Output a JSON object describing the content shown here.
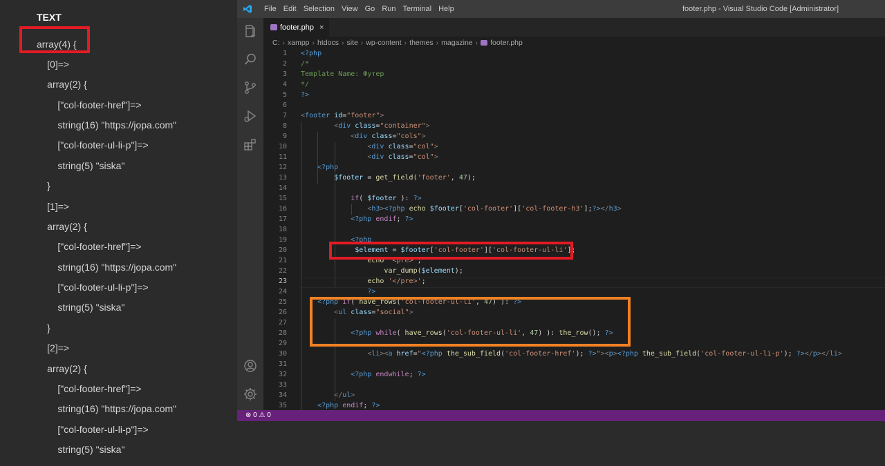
{
  "dump": {
    "title": "TEXT",
    "lines": [
      "array(4) {",
      "  [0]=>",
      "  array(2) {",
      "    [\"col-footer-href\"]=>",
      "    string(16) \"https://jopa.com\"",
      "    [\"col-footer-ul-li-p\"]=>",
      "    string(5) \"siska\"",
      "  }",
      "  [1]=>",
      "  array(2) {",
      "    [\"col-footer-href\"]=>",
      "    string(16) \"https://jopa.com\"",
      "    [\"col-footer-ul-li-p\"]=>",
      "    string(5) \"siska\"",
      "  }",
      "  [2]=>",
      "  array(2) {",
      "    [\"col-footer-href\"]=>",
      "    string(16) \"https://jopa.com\"",
      "    [\"col-footer-ul-li-p\"]=>",
      "    string(5) \"siska\""
    ]
  },
  "window": {
    "title": "footer.php - Visual Studio Code [Administrator]",
    "menu": [
      "File",
      "Edit",
      "Selection",
      "View",
      "Go",
      "Run",
      "Terminal",
      "Help"
    ]
  },
  "tab": {
    "name": "footer.php",
    "close": "×"
  },
  "breadcrumb": [
    "C:",
    "xampp",
    "htdocs",
    "site",
    "wp-content",
    "themes",
    "magazine",
    "footer.php"
  ],
  "editor": {
    "active_line": 23,
    "line_numbers": [
      "1",
      "2",
      "3",
      "4",
      "5",
      "6",
      "7",
      "8",
      "9",
      "10",
      "11",
      "12",
      "13",
      "14",
      "15",
      "16",
      "17",
      "18",
      "19",
      "20",
      "21",
      "22",
      "23",
      "24",
      "25",
      "26",
      "27",
      "28",
      "29",
      "30",
      "31",
      "32",
      "33",
      "34",
      "35"
    ]
  },
  "status": {
    "text": "⊗ 0 ⚠ 0"
  },
  "colors": {
    "status_bar": "#68217a",
    "highlight_red": "#e21b24",
    "highlight_orange": "#f08124",
    "editor_bg": "#1e1e1e"
  },
  "icons": [
    "vscode-logo-icon",
    "explorer-icon",
    "search-icon",
    "source-control-icon",
    "run-debug-icon",
    "extensions-icon",
    "account-icon",
    "settings-gear-icon",
    "php-file-icon"
  ]
}
